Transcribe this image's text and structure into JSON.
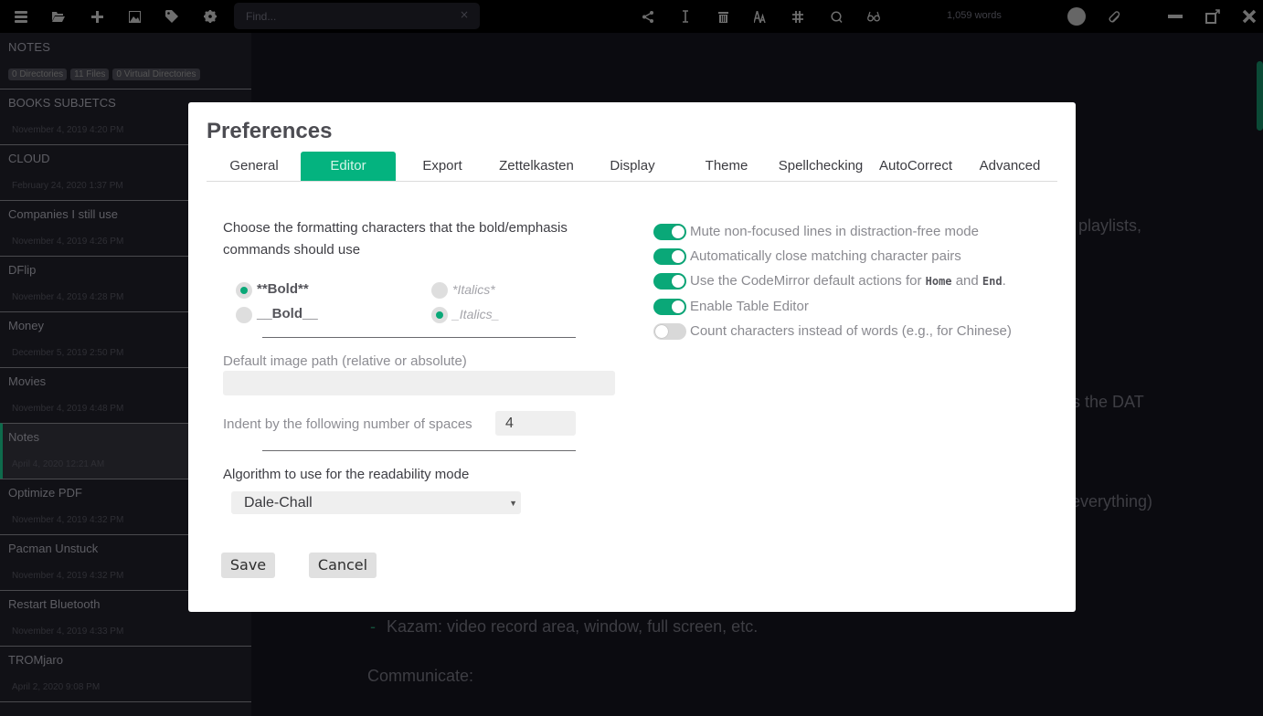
{
  "toolbar": {
    "left_icons": [
      "menu-icon",
      "folder-open-icon",
      "plus-icon",
      "image-icon",
      "tag-icon",
      "gear-icon"
    ],
    "search": {
      "placeholder": "Find...",
      "value": "",
      "clear": "×"
    },
    "right_icons": [
      "share-icon",
      "text-cursor-icon",
      "trash-icon",
      "font-size-icon",
      "hashtag-icon",
      "search-icon",
      "glasses-icon"
    ],
    "word_count": "1,059 words",
    "window_controls": [
      "minimize-icon",
      "maximize-icon",
      "close-icon"
    ]
  },
  "sidebar": {
    "title": "NOTES",
    "badges": [
      "0 Directories",
      "11 Files",
      "0 Virtual Directories"
    ],
    "files": [
      {
        "name": "BOOKS SUBJETCS",
        "date": "November 4, 2019 4:20 PM",
        "active": false
      },
      {
        "name": "CLOUD",
        "date": "February 24, 2020 1:37 PM",
        "active": false
      },
      {
        "name": "Companies I still use",
        "date": "November 4, 2019 4:26 PM",
        "active": false
      },
      {
        "name": "DFlip",
        "date": "November 4, 2019 4:28 PM",
        "active": false
      },
      {
        "name": "Money",
        "date": "December 5, 2019 2:50 PM",
        "active": false
      },
      {
        "name": "Movies",
        "date": "November 4, 2019 4:48 PM",
        "active": false
      },
      {
        "name": "Notes",
        "date": "April 4, 2020 12:21 AM",
        "active": true
      },
      {
        "name": "Optimize PDF",
        "date": "November 4, 2019 4:32 PM",
        "active": false
      },
      {
        "name": "Pacman Unstuck",
        "date": "November 4, 2019 4:32 PM",
        "active": false
      },
      {
        "name": "Restart Bluetooth",
        "date": "November 4, 2019 4:33 PM",
        "active": false
      },
      {
        "name": "TROMjaro",
        "date": "April 2, 2020 9:08 PM",
        "active": false
      }
    ]
  },
  "editor": {
    "fragments": {
      "playlists": "playlists,",
      "dat": "s the DAT",
      "everything": "everything)",
      "kazam": "Kazam: video record area, window, full screen, etc.",
      "communicate": "Communicate:",
      "bullet": "-"
    }
  },
  "preferences": {
    "title": "Preferences",
    "tabs": [
      "General",
      "Editor",
      "Export",
      "Zettelkasten",
      "Display",
      "Theme",
      "Spellchecking",
      "AutoCorrect",
      "Advanced"
    ],
    "active_tab": "Editor",
    "formatting": {
      "label": "Choose the formatting characters that the bold/emphasis commands should use",
      "bold_options": [
        {
          "label": "**Bold**",
          "selected": true
        },
        {
          "label": "__Bold__",
          "selected": false
        }
      ],
      "italic_options": [
        {
          "label": "*Italics*",
          "selected": false
        },
        {
          "label": "_Italics_",
          "selected": true
        }
      ]
    },
    "image_path": {
      "label": "Default image path (relative or absolute)",
      "value": ""
    },
    "indent": {
      "label": "Indent by the following number of spaces",
      "value": "4"
    },
    "readability": {
      "label": "Algorithm to use for the readability mode",
      "selected": "Dale-Chall"
    },
    "toggles": [
      {
        "label": "Mute non-focused lines in distraction-free mode",
        "on": true
      },
      {
        "label": "Automatically close matching character pairs",
        "on": true
      },
      {
        "label_prefix": "Use the CodeMirror default actions for ",
        "code1": "Home",
        "mid": " and ",
        "code2": "End",
        "suffix": ".",
        "on": true
      },
      {
        "label": "Enable Table Editor",
        "on": true
      },
      {
        "label": "Count characters instead of words (e.g., for Chinese)",
        "on": false
      }
    ],
    "buttons": {
      "save": "Save",
      "cancel": "Cancel"
    },
    "accent_color": "#04b37f"
  }
}
